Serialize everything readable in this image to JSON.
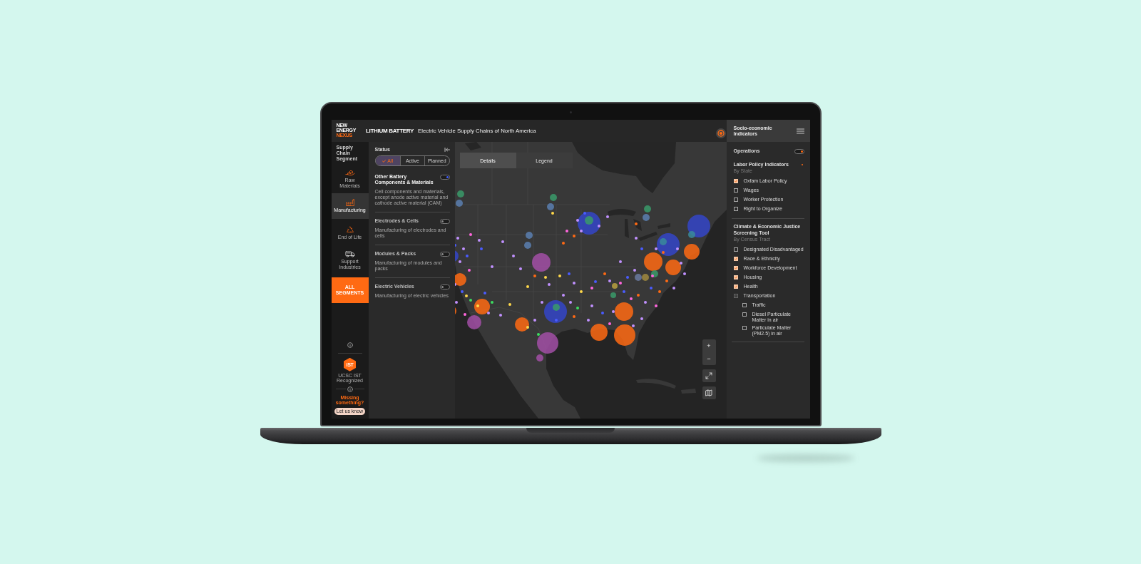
{
  "logo": {
    "lines": [
      "NEW",
      "ENERGY",
      "NEXUS"
    ]
  },
  "header": {
    "title": "LITHIUM BATTERY",
    "subtitle": "Electric Vehicle Supply Chains of North America"
  },
  "sidebar": {
    "heading": "Supply Chain Segment",
    "items": [
      {
        "label": "Raw Materials",
        "selected": false
      },
      {
        "label": "Manufacturing",
        "selected": true
      },
      {
        "label": "End of Life",
        "selected": false
      },
      {
        "label": "Support Industries",
        "selected": false
      }
    ],
    "all_button": "ALL SEGMENTS",
    "badge": {
      "logo": "iST",
      "caption": "UCSC IST Recognized"
    },
    "prompt": "Missing something?",
    "feedback_button": "Let us know"
  },
  "filters": {
    "status_label": "Status",
    "status_options": [
      {
        "label": "All",
        "selected": true
      },
      {
        "label": "Active",
        "selected": false
      },
      {
        "label": "Planned",
        "selected": false
      }
    ],
    "segments": [
      {
        "title": "Other Battery Components & Materials",
        "description": "Cell components and materials, except anode active material and cathode active material (CAM)",
        "on": true
      },
      {
        "title": "Electrodes & Cells",
        "description": "Manufacturing of electrodes and cells",
        "on": false
      },
      {
        "title": "Modules & Packs",
        "description": "Manufacturing of modules and packs",
        "on": false
      },
      {
        "title": "Electric Vehicles",
        "description": "Manufacturing of electric vehicles",
        "on": false
      }
    ]
  },
  "map": {
    "tabs": [
      {
        "label": "Details",
        "selected": true
      },
      {
        "label": "Legend",
        "selected": false
      }
    ],
    "zoom_in": "+",
    "zoom_out": "−"
  },
  "right_panel": {
    "title": "Socio-economic Indicators",
    "operations": {
      "label": "Operations",
      "on": true
    },
    "groups": [
      {
        "title": "Labor Policy Indicators",
        "subtitle": "By State",
        "indicator_dot": true,
        "items": [
          {
            "label": "Oxfam Labor Policy",
            "checked": true,
            "mixed": false
          },
          {
            "label": "Wages",
            "checked": false,
            "mixed": false
          },
          {
            "label": "Worker Protection",
            "checked": false,
            "mixed": false
          },
          {
            "label": "Right to Organize",
            "checked": false,
            "mixed": false
          }
        ]
      },
      {
        "title": "Climate & Economic Justice Screening Tool",
        "subtitle": "By Census Tract",
        "indicator_dot": false,
        "items": [
          {
            "label": "Designated Disadvantaged",
            "checked": false,
            "mixed": false
          },
          {
            "label": "Race & Ethnicity",
            "checked": true,
            "mixed": false
          },
          {
            "label": "Workforce Development",
            "checked": true,
            "mixed": false
          },
          {
            "label": "Housing",
            "checked": true,
            "mixed": false
          },
          {
            "label": "Health",
            "checked": true,
            "mixed": false
          },
          {
            "label": "Transportation",
            "checked": false,
            "mixed": true,
            "children": [
              {
                "label": "Traffic",
                "checked": false,
                "mixed": false
              },
              {
                "label": "Diesel Particulate Matter in air",
                "checked": false,
                "mixed": false
              },
              {
                "label": "Particulate Matter (PM2.5) in air",
                "checked": false,
                "mixed": false
              }
            ]
          }
        ]
      }
    ]
  }
}
